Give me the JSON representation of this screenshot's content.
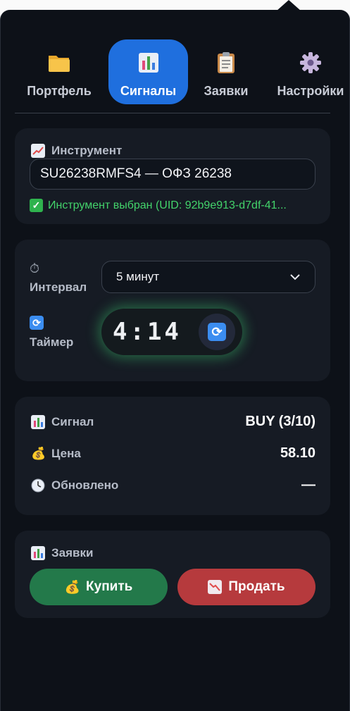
{
  "tabs": [
    {
      "label": "Портфель",
      "icon": "folder-icon",
      "active": false
    },
    {
      "label": "Сигналы",
      "icon": "bar-chart-icon",
      "active": true
    },
    {
      "label": "Заявки",
      "icon": "clipboard-icon",
      "active": false
    },
    {
      "label": "Настройки",
      "icon": "gear-icon",
      "active": false
    }
  ],
  "instrument": {
    "title": "Инструмент",
    "value": "SU26238RMFS4 — ОФЗ 26238",
    "status": "Инструмент выбран (UID: 92b9e913-d7df-41..."
  },
  "interval": {
    "label": "Интервал",
    "selected": "5 минут"
  },
  "timer": {
    "label": "Таймер",
    "value": "4:14"
  },
  "signal": {
    "signal_label": "Сигнал",
    "signal_value": "BUY (3/10)",
    "price_label": "Цена",
    "price_value": "58.10",
    "updated_label": "Обновлено",
    "updated_value": "—"
  },
  "orders": {
    "title": "Заявки",
    "buy_label": "Купить",
    "sell_label": "Продать"
  },
  "colors": {
    "accent": "#1f6fde",
    "success": "#43d36b",
    "buy": "#23794a",
    "sell": "#b63a3d"
  }
}
